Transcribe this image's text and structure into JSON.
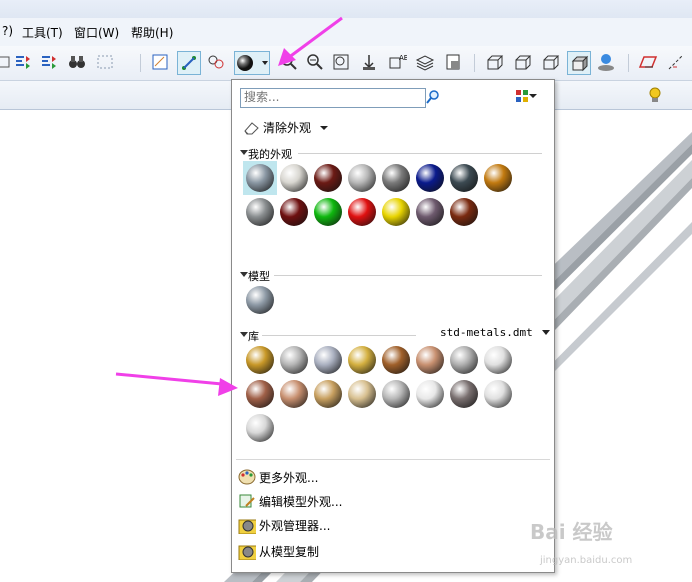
{
  "menus": [
    {
      "label": "?)"
    },
    {
      "label": "工具(T)"
    },
    {
      "label": "窗口(W)"
    },
    {
      "label": "帮助(H)"
    }
  ],
  "popup": {
    "search_placeholder": "搜索...",
    "clear_label": "清除外观",
    "sections": {
      "my": "我的外观",
      "model": "模型",
      "library": "库",
      "library_file": "std-metals.dmt"
    },
    "my_balls": [
      "#8a97a3",
      "#d8d6d0",
      "#6b1a14",
      "#b8b8b8",
      "#7a7a7a",
      "#0a1a8c",
      "#3c4a52",
      "#c27a10",
      "#8a8e90",
      "#6e1010",
      "#0fb80f",
      "#e01010",
      "#e8d400",
      "#6e5a6e",
      "#7a2a10"
    ],
    "model_balls": [
      "#8e9aa6"
    ],
    "lib_balls": [
      "#c89828",
      "#b6b6b6",
      "#aab0c0",
      "#d4b040",
      "#a0602a",
      "#c89070",
      "#b0b0b0",
      "#e0e0e0",
      "#a06048",
      "#c89070",
      "#c8a060",
      "#d8c090",
      "#b8b8b8",
      "#e8e8e8",
      "#7a7070",
      "#e0e0e0",
      "#d8d8d8"
    ],
    "bottom_items": [
      {
        "label": "更多外观..."
      },
      {
        "label": "编辑模型外观..."
      },
      {
        "label": "外观管理器..."
      },
      {
        "label": "从模型复制"
      }
    ]
  },
  "watermark": {
    "main": "Bai 经验",
    "sub": "jingyan.baidu.com"
  }
}
